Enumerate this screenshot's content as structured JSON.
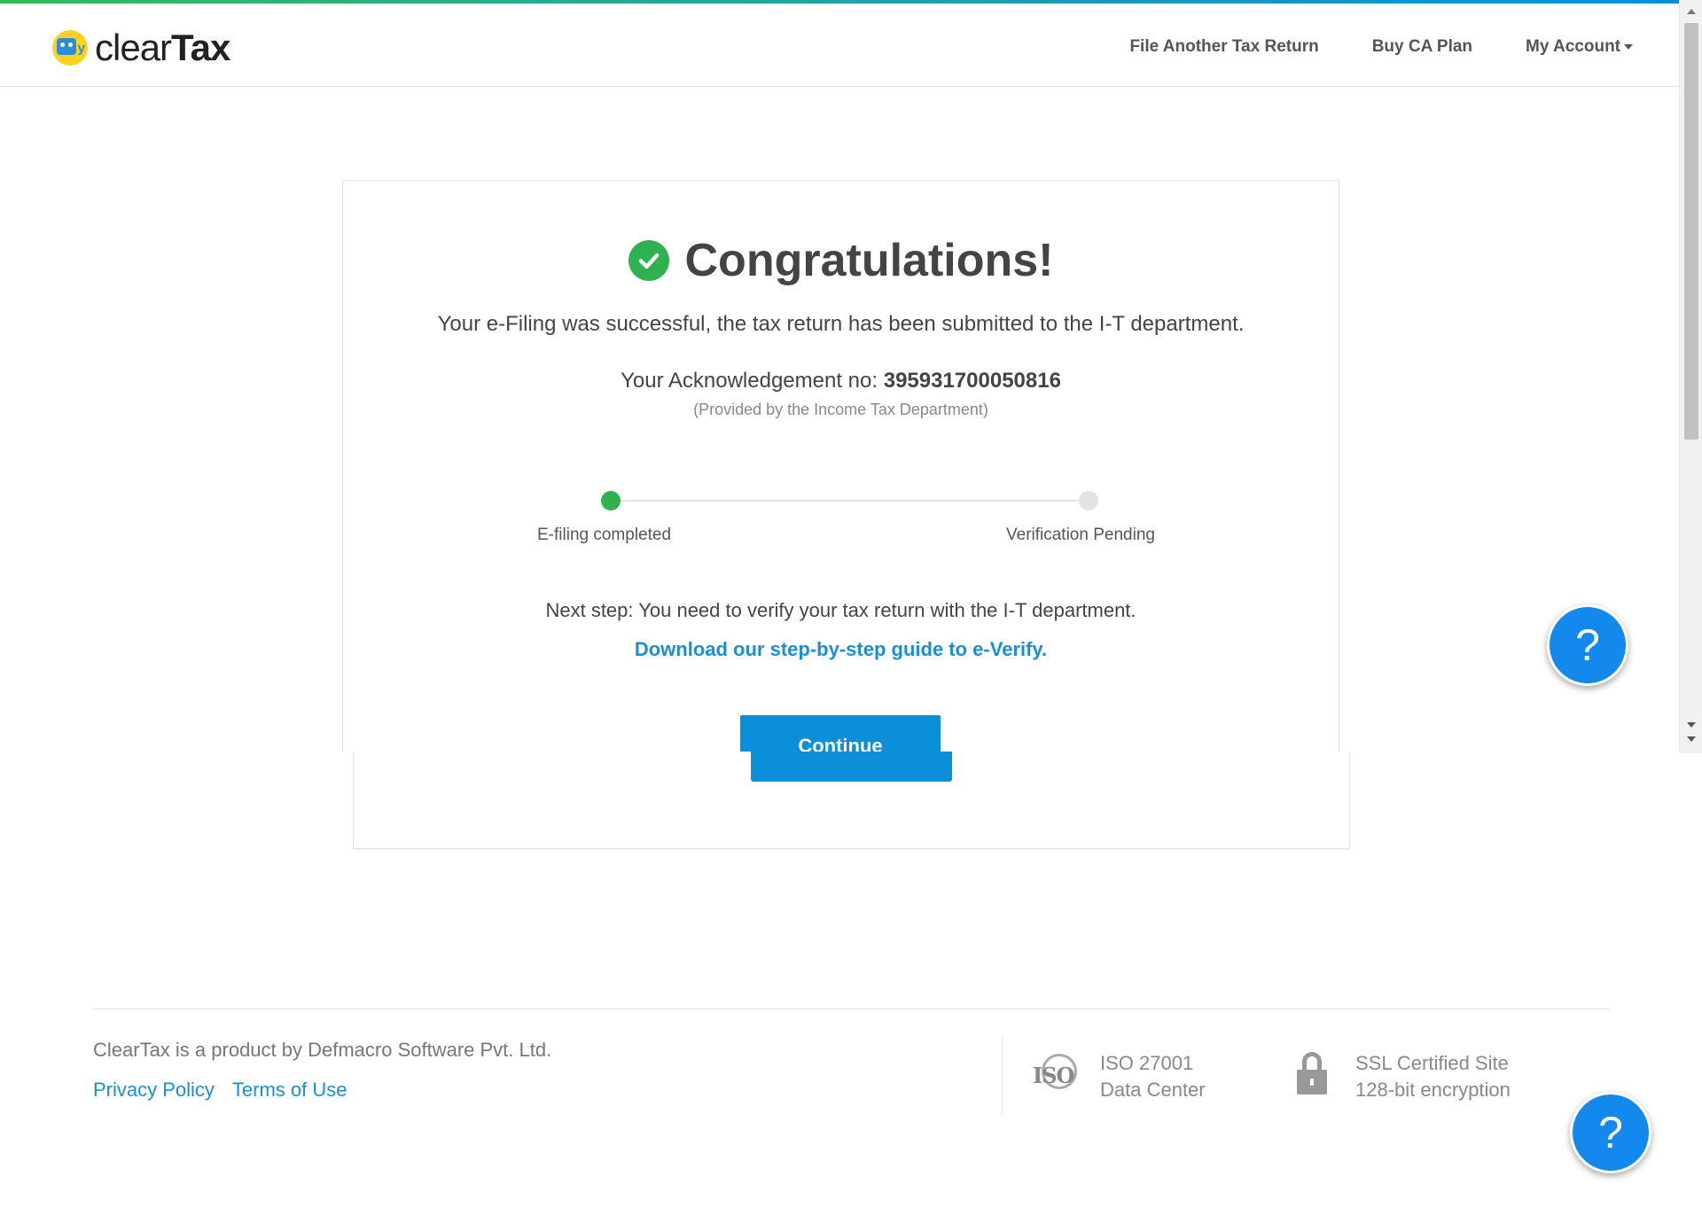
{
  "brand": {
    "name_light": "clear",
    "name_bold": "Tax",
    "accent_color": "#0b8fd9",
    "success_color": "#2eb14f"
  },
  "nav": {
    "items": [
      {
        "label": "File Another Tax Return"
      },
      {
        "label": "Buy CA Plan"
      },
      {
        "label": "My Account"
      }
    ]
  },
  "confirmation": {
    "title": "Congratulations!",
    "message": "Your e-Filing was successful, the tax return has been submitted to the I-T department.",
    "ack_label": "Your Acknowledgement no: ",
    "ack_number": "395931700050816",
    "ack_note": "(Provided by the Income Tax Department)",
    "steps": [
      {
        "label": "E-filing completed",
        "status": "done"
      },
      {
        "label": "Verification Pending",
        "status": "pending"
      }
    ],
    "next_step": "Next step: You need to verify your tax return with the I-T department.",
    "guide_link": "Download our step-by-step guide to e-Verify.",
    "continue_label": "Continue"
  },
  "help": {
    "label": "?"
  },
  "footer": {
    "copyright": "ClearTax is a product by Defmacro Software Pvt. Ltd.",
    "links": [
      "Privacy Policy",
      "Terms of Use"
    ],
    "badges": [
      {
        "icon": "iso-icon",
        "icon_text": "ISO",
        "line1": "ISO 27001",
        "line2": "Data Center"
      },
      {
        "icon": "lock-icon",
        "line1": "SSL Certified Site",
        "line2": "128-bit encryption"
      }
    ]
  }
}
